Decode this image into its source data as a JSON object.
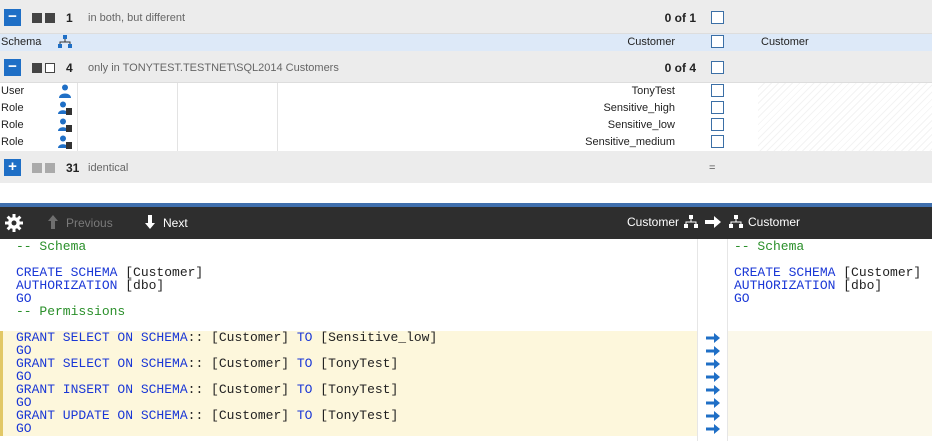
{
  "groups": [
    {
      "count": "1",
      "label": "in both, but different",
      "ratio": "0 of 1",
      "expanded": true
    },
    {
      "count": "4",
      "label": "only in TONYTEST.TESTNET\\SQL2014 Customers",
      "ratio": "0 of 4",
      "expanded": true
    },
    {
      "count": "31",
      "label": "identical",
      "ratio": "=",
      "expanded": false
    }
  ],
  "rows_group1": [
    {
      "type": "Schema",
      "icon": "schema-icon",
      "name": "Customer",
      "target": "Customer"
    }
  ],
  "rows_group2": [
    {
      "type": "User",
      "icon": "user-icon",
      "name": "TonyTest"
    },
    {
      "type": "Role",
      "icon": "role-icon",
      "name": "Sensitive_high"
    },
    {
      "type": "Role",
      "icon": "role-icon",
      "name": "Sensitive_low"
    },
    {
      "type": "Role",
      "icon": "role-icon",
      "name": "Sensitive_medium"
    }
  ],
  "toolbar": {
    "previous_label": "Previous",
    "next_label": "Next",
    "left_object": "Customer",
    "right_object": "Customer"
  },
  "sql_left": [
    [
      [
        "cm",
        "-- Schema"
      ]
    ],
    [],
    [
      [
        "kw",
        "CREATE SCHEMA"
      ],
      [
        "tx",
        " [Customer]"
      ]
    ],
    [
      [
        "kw",
        "AUTHORIZATION"
      ],
      [
        "tx",
        " [dbo]"
      ]
    ],
    [
      [
        "kw",
        "GO"
      ]
    ],
    [
      [
        "cm",
        "-- Permissions"
      ]
    ],
    [],
    [
      [
        "kw",
        "GRANT SELECT ON SCHEMA"
      ],
      [
        "tx",
        ":: [Customer] "
      ],
      [
        "kw",
        "TO"
      ],
      [
        "tx",
        " [Sensitive_low]"
      ]
    ],
    [
      [
        "kw",
        "GO"
      ]
    ],
    [
      [
        "kw",
        "GRANT SELECT ON SCHEMA"
      ],
      [
        "tx",
        ":: [Customer] "
      ],
      [
        "kw",
        "TO"
      ],
      [
        "tx",
        " [TonyTest]"
      ]
    ],
    [
      [
        "kw",
        "GO"
      ]
    ],
    [
      [
        "kw",
        "GRANT INSERT ON SCHEMA"
      ],
      [
        "tx",
        ":: [Customer] "
      ],
      [
        "kw",
        "TO"
      ],
      [
        "tx",
        " [TonyTest]"
      ]
    ],
    [
      [
        "kw",
        "GO"
      ]
    ],
    [
      [
        "kw",
        "GRANT UPDATE ON SCHEMA"
      ],
      [
        "tx",
        ":: [Customer] "
      ],
      [
        "kw",
        "TO"
      ],
      [
        "tx",
        " [TonyTest]"
      ]
    ],
    [
      [
        "kw",
        "GO"
      ]
    ]
  ],
  "sql_right": [
    [
      [
        "cm",
        "-- Schema"
      ]
    ],
    [],
    [
      [
        "kw",
        "CREATE SCHEMA"
      ],
      [
        "tx",
        " [Customer]"
      ]
    ],
    [
      [
        "kw",
        "AUTHORIZATION"
      ],
      [
        "tx",
        " [dbo]"
      ]
    ],
    [
      [
        "kw",
        "GO"
      ]
    ]
  ],
  "colors": {
    "accent": "#1f6fc6",
    "toolbar_bg": "#2e2e2e",
    "diff_bg": "#fdf7dc",
    "keyword": "#1a37d6",
    "comment": "#2a8f2a"
  }
}
